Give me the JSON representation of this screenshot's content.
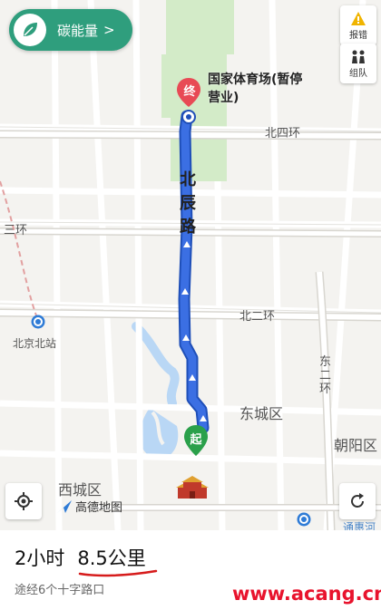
{
  "carbon_button": {
    "label": "碳能量",
    "arrow": ">",
    "icon": "leaf-icon"
  },
  "side_buttons": {
    "report_label": "报错",
    "team_label": "组队"
  },
  "destination": {
    "marker": "终",
    "name": "国家体育场(暂停营业)"
  },
  "origin": {
    "marker": "起"
  },
  "route_road": {
    "label": "北辰路"
  },
  "map_labels": {
    "beisihuan": "北四环",
    "beierhuan": "北二环",
    "sanhuan": "三环",
    "beijing_north": "北京北站",
    "dongsanhuan": "东二环",
    "dongcheng": "东城区",
    "xicheng": "西城区",
    "chaoyang": "朝阳区",
    "tonghui": "通惠河"
  },
  "brand": {
    "label": "高德地图"
  },
  "summary": {
    "duration": "2小时",
    "distance": "8.5公里",
    "detail": "途经6个十字路口"
  },
  "watermark": "www.acang.cn",
  "colors": {
    "route": "#3b6fe3",
    "carbon": "#2f9e7d",
    "destination": "#e84a55",
    "origin": "#2aa04a",
    "watermark": "#e8132d"
  }
}
